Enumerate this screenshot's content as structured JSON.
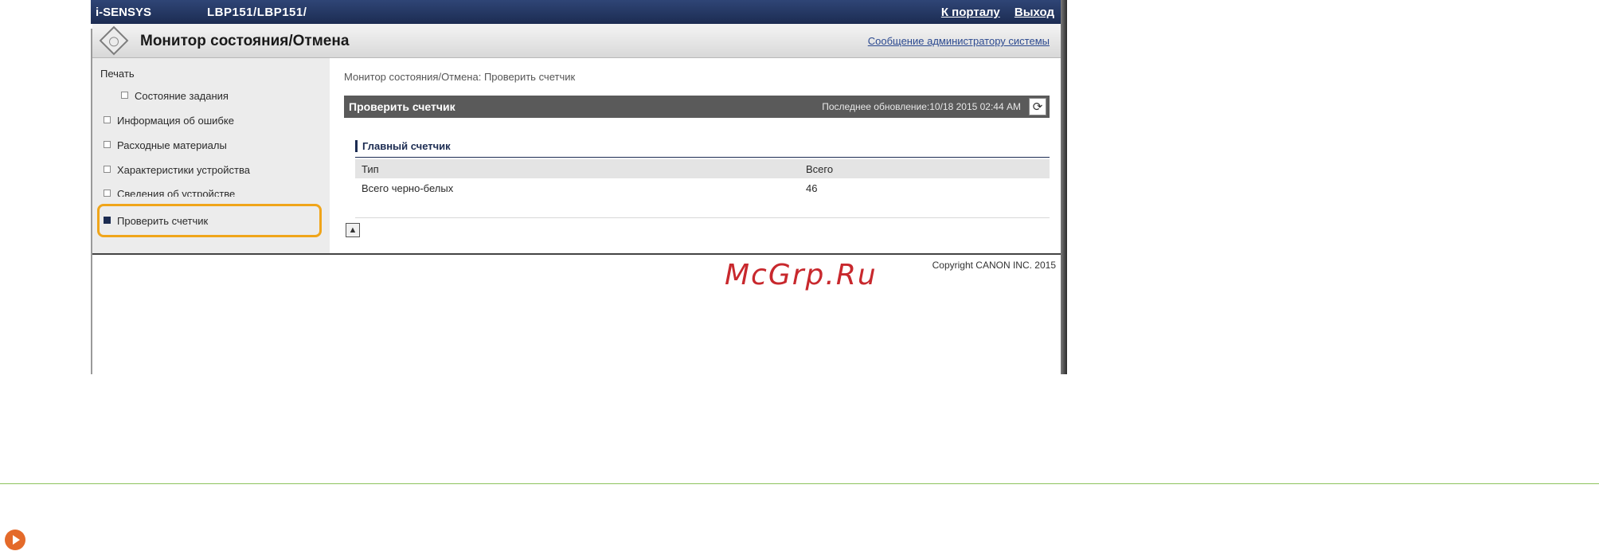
{
  "topbar": {
    "brand": "i-SENSYS",
    "model": "LBP151/LBP151/",
    "portal_link": "К порталу",
    "logout_link": "Выход"
  },
  "header": {
    "title": "Монитор состояния/Отмена",
    "admin_message_link": "Сообщение администратору системы"
  },
  "sidebar": {
    "section_label": "Печать",
    "items": [
      {
        "label": "Состояние задания",
        "sub": true
      },
      {
        "label": "Информация об ошибке"
      },
      {
        "label": "Расходные материалы"
      },
      {
        "label": "Характеристики устройства"
      },
      {
        "label": "Сведения об устройстве"
      },
      {
        "label": "Проверить счетчик",
        "active": true
      }
    ]
  },
  "content": {
    "breadcrumb": "Монитор состояния/Отмена: Проверить счетчик",
    "panel_title": "Проверить счетчик",
    "last_updated": "Последнее обновление:10/18 2015 02:44 AM",
    "section_title": "Главный счетчик",
    "table": {
      "headers": [
        "Тип",
        "Всего"
      ],
      "rows": [
        [
          "Всего черно-белых",
          "46"
        ]
      ]
    },
    "copyright": "Copyright CANON INC. 2015"
  },
  "watermark": "McGrp.Ru",
  "icons": {
    "logo": "status-monitor-icon",
    "refresh": "refresh-icon",
    "top": "go-top-icon",
    "next": "play-arrow-icon"
  },
  "colors": {
    "topbar": "#1c2c52",
    "panel_header": "#5a5a5a",
    "highlight": "#f0a51a",
    "watermark": "#c8282d",
    "divider": "#8dc35c",
    "play_icon": "#e46a2a"
  }
}
